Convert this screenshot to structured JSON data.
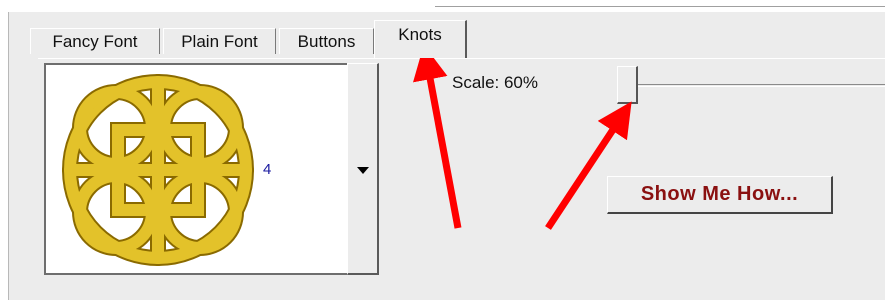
{
  "tabs": [
    {
      "label": "Fancy Font"
    },
    {
      "label": "Plain Font"
    },
    {
      "label": "Buttons"
    },
    {
      "label": "Knots"
    }
  ],
  "active_tab": "Knots",
  "knot_preview": {
    "number": "4",
    "icon": "celtic-knot-icon",
    "color": "#e3c22a"
  },
  "scale": {
    "label": "Scale: 60%"
  },
  "show_me_button": {
    "label": "Show Me How..."
  },
  "annotation_color": "#ff0000"
}
